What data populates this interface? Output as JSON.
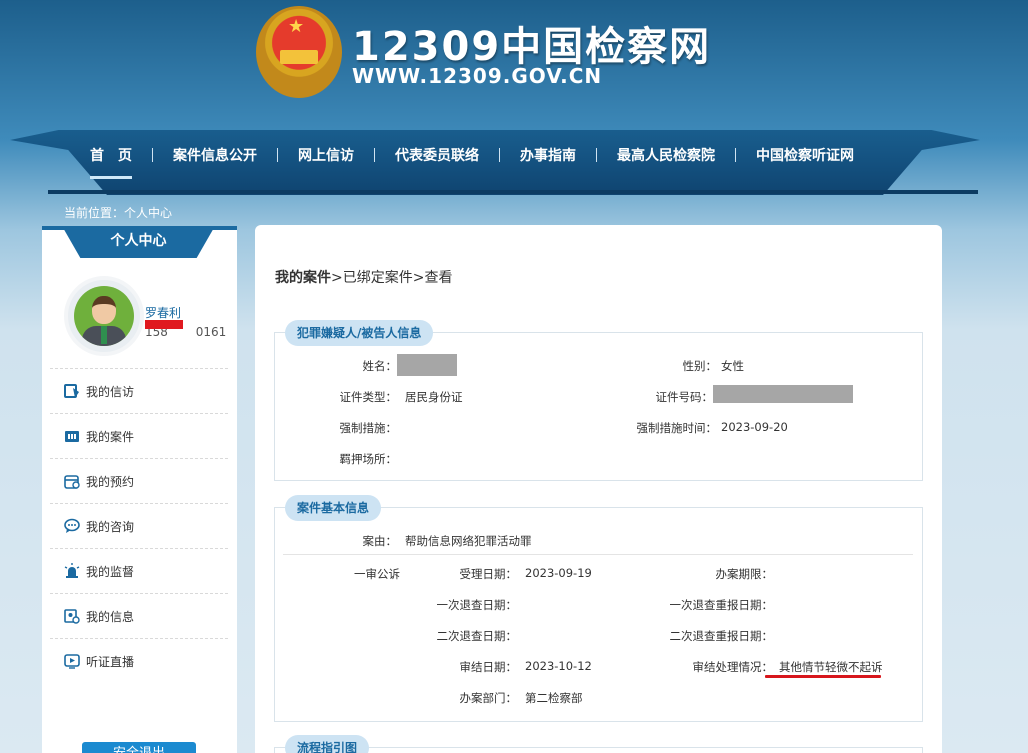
{
  "site": {
    "title": "12309中国检察网",
    "url": "WWW.12309.GOV.CN"
  },
  "nav": {
    "items": [
      "首　页",
      "案件信息公开",
      "网上信访",
      "代表委员联络",
      "办事指南",
      "最高人民检察院",
      "中国检察听证网"
    ]
  },
  "location": "当前位置：个人中心",
  "sidebar": {
    "title": "个人中心",
    "user_name": "罗春利",
    "user_phone": "158 　　0161",
    "menu": [
      "我的信访",
      "我的案件",
      "我的预约",
      "我的咨询",
      "我的监督",
      "我的信息",
      "听证直播"
    ],
    "logout": "安全退出"
  },
  "breadcrumb": {
    "first": "我的案件",
    "rest": ">已绑定案件>查看"
  },
  "suspect": {
    "tag": "犯罪嫌疑人/被告人信息",
    "name_label": "姓名：",
    "gender_label": "性别：",
    "gender": "女性",
    "id_type_label": "证件类型：",
    "id_type": "居民身份证",
    "id_no_label": "证件号码：",
    "measure_label": "强制措施：",
    "measure_time_label": "强制措施时间：",
    "measure_time": "2023-09-20",
    "detention_label": "羁押场所："
  },
  "case": {
    "tag": "案件基本信息",
    "cause_label": "案由：",
    "cause": "帮助信息网络犯罪活动罪",
    "stage": "一审公诉",
    "accept_label": "受理日期：",
    "accept_date": "2023-09-19",
    "deadline_label": "办案期限：",
    "return1_label": "一次退查日期：",
    "resubmit1_label": "一次退查重报日期：",
    "return2_label": "二次退查日期：",
    "resubmit2_label": "二次退查重报日期：",
    "close_label": "审结日期：",
    "close_date": "2023-10-12",
    "result_label": "审结处理情况：",
    "result": "其他情节轻微不起诉",
    "dept_label": "办案部门：",
    "dept": "第二检察部"
  },
  "process": {
    "tag": "流程指引图"
  },
  "colors": {
    "brand": "#1b6aa1",
    "tag_bg": "#cde3f3",
    "redaction": "#a6a6a6",
    "highlight_red": "#d7161c"
  }
}
